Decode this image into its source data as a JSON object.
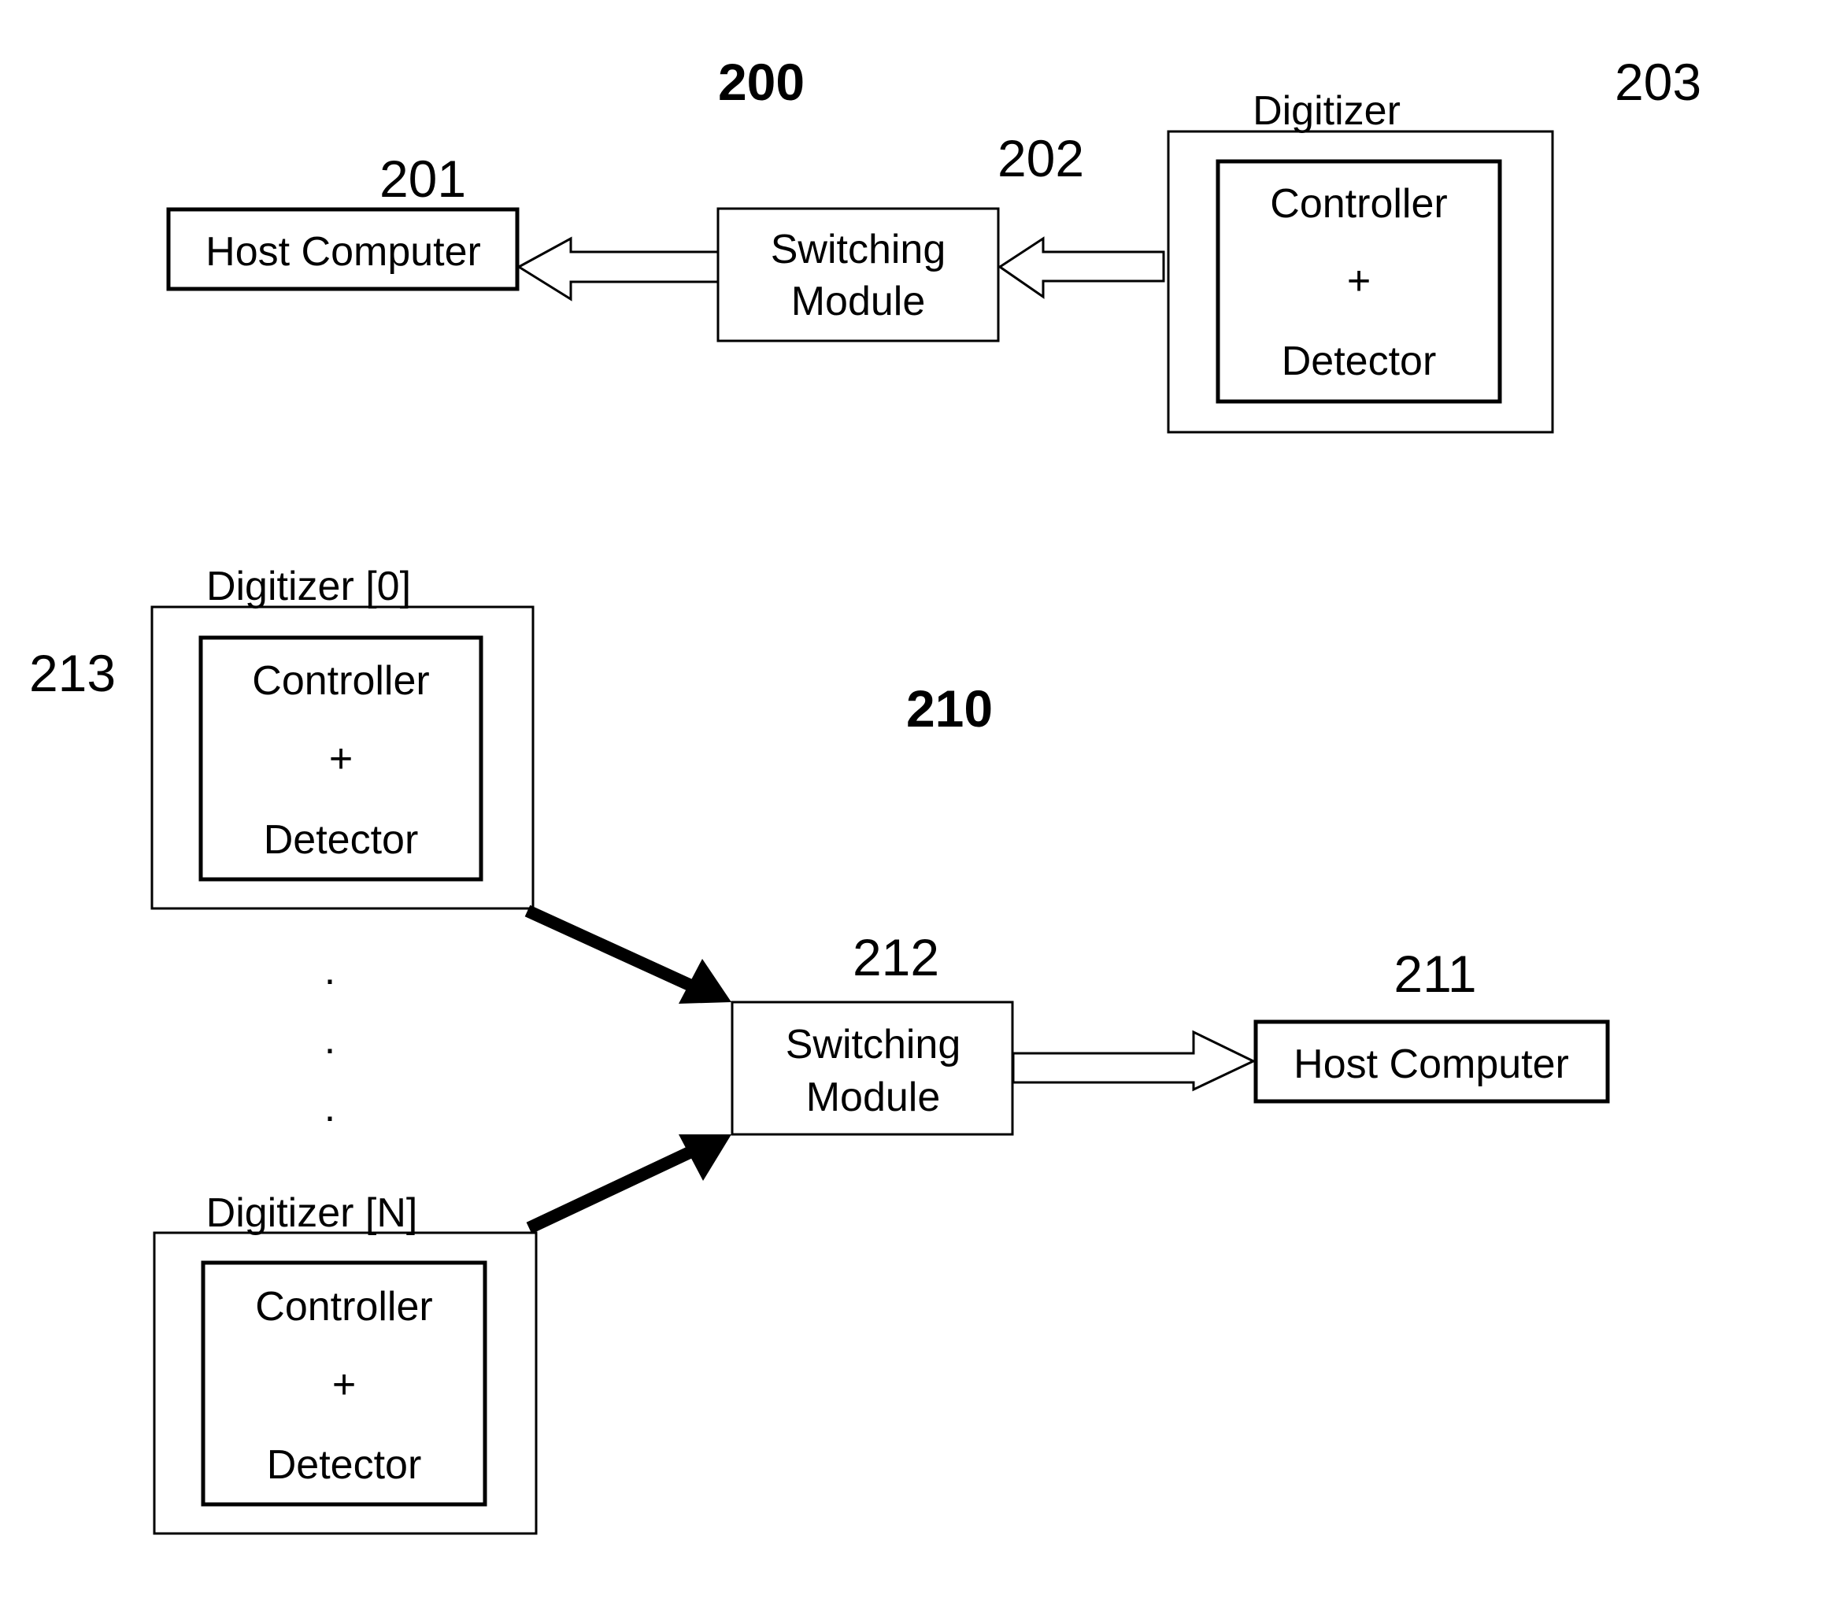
{
  "figure_top": {
    "figure_number": "200",
    "host": {
      "ref": "201",
      "label": "Host Computer"
    },
    "switch": {
      "ref": "202",
      "line1": "Switching",
      "line2": "Module"
    },
    "digitizer": {
      "ref": "203",
      "title": "Digitizer",
      "line1": "Controller",
      "plus": "+",
      "line2": "Detector"
    },
    "arrows": [
      {
        "from": "Digitizer",
        "to": "Switching Module",
        "style": "hollow-block"
      },
      {
        "from": "Switching Module",
        "to": "Host Computer",
        "style": "hollow-block"
      }
    ]
  },
  "figure_bottom": {
    "figure_number": "210",
    "group_ref": "213",
    "digitizers": [
      {
        "title": "Digitizer [0]",
        "line1": "Controller",
        "plus": "+",
        "line2": "Detector"
      },
      {
        "title": "Digitizer [N]",
        "line1": "Controller",
        "plus": "+",
        "line2": "Detector"
      }
    ],
    "ellipsis": ".",
    "switch": {
      "ref": "212",
      "line1": "Switching",
      "line2": "Module"
    },
    "host": {
      "ref": "211",
      "label": "Host Computer"
    },
    "arrows": [
      {
        "from": "Digitizer [0]",
        "to": "Switching Module",
        "style": "solid-thick"
      },
      {
        "from": "Digitizer [N]",
        "to": "Switching Module",
        "style": "solid-thick"
      },
      {
        "from": "Switching Module",
        "to": "Host Computer",
        "style": "hollow-block"
      }
    ]
  }
}
